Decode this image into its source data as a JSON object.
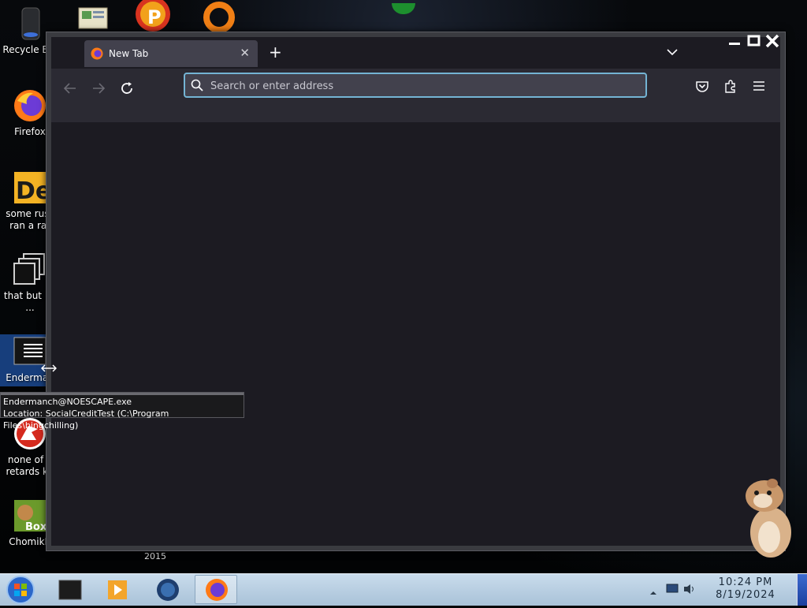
{
  "desktop": {
    "icons": [
      {
        "label_1": "Recycle Bin",
        "label_2": ""
      },
      {
        "label_1": "Firefox",
        "label_2": ""
      },
      {
        "label_1": "some russ",
        "label_2": "ran a rat"
      },
      {
        "label_1": "that but its",
        "label_2": "..."
      },
      {
        "label_1": "Enderman",
        "label_2": ""
      },
      {
        "label_1": "none of y",
        "label_2": "retards kn"
      },
      {
        "label_1": "ChomikB",
        "label_2": ""
      }
    ],
    "year_text": "2015"
  },
  "tooltip": {
    "line_1": "Endermanch@NOESCAPE.exe",
    "line_2": "Location: SocialCreditTest (C:\\Program Files\\bingchilling)"
  },
  "browser": {
    "tab_title": "New Tab",
    "address_placeholder": "Search or enter address",
    "address_value": ""
  },
  "taskbar": {
    "time": "10:24 PM",
    "date": "8/19/2024"
  },
  "colors": {
    "browser_bg": "#1c1b22",
    "toolbar_bg": "#2b2a33",
    "focus_ring": "#74b4d4",
    "taskbar": "#b4cce0"
  }
}
